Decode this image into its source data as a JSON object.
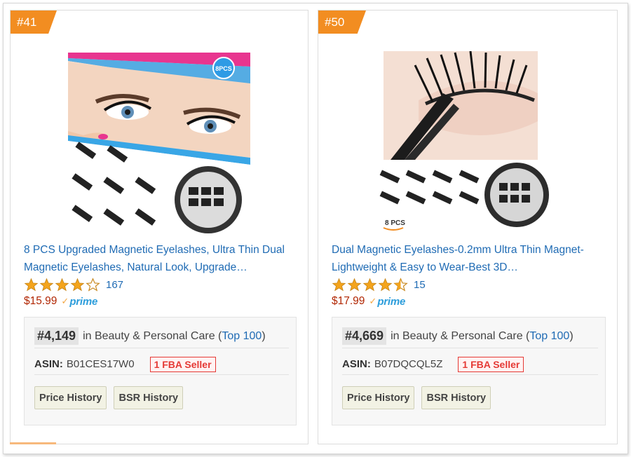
{
  "cards": [
    {
      "rank": "#41",
      "title": "8 PCS Upgraded Magnetic Eyelashes, Ultra Thin Dual Magnetic Eyelashes, Natural Look, Upgrade…",
      "rating": 4,
      "review_count": "167",
      "price": "$15.99",
      "prime_label": "prime",
      "bsr_rank": "#4,149",
      "bsr_category_prefix": "in Beauty & Personal Care (",
      "bsr_link": "Top 100",
      "bsr_category_suffix": ")",
      "asin_label": "ASIN:",
      "asin_value": "B01CES17W0",
      "fba_badge": "1 FBA Seller",
      "price_history_label": "Price History",
      "bsr_history_label": "BSR History",
      "image_badge": "8PCS"
    },
    {
      "rank": "#50",
      "title": "Dual Magnetic Eyelashes-0.2mm Ultra Thin Magnet-Lightweight & Easy to Wear-Best 3D…",
      "rating": 4.5,
      "review_count": "15",
      "price": "$17.99",
      "prime_label": "prime",
      "bsr_rank": "#4,669",
      "bsr_category_prefix": "in Beauty & Personal Care (",
      "bsr_link": "Top 100",
      "bsr_category_suffix": ")",
      "asin_label": "ASIN:",
      "asin_value": "B07DQCQL5Z",
      "fba_badge": "1 FBA Seller",
      "price_history_label": "Price History",
      "bsr_history_label": "BSR History",
      "image_badge": "8 PCS"
    }
  ],
  "colors": {
    "rank_tab": "#f28d21",
    "link": "#1f6bb4",
    "price": "#b12704",
    "star": "#f4a41c",
    "prime": "#2c9ddb",
    "fba_badge": "#e53935"
  },
  "icons": {
    "star_full": "star-icon",
    "star_half": "star-half-icon",
    "star_empty": "star-empty-icon",
    "prime_check": "checkmark-icon"
  }
}
